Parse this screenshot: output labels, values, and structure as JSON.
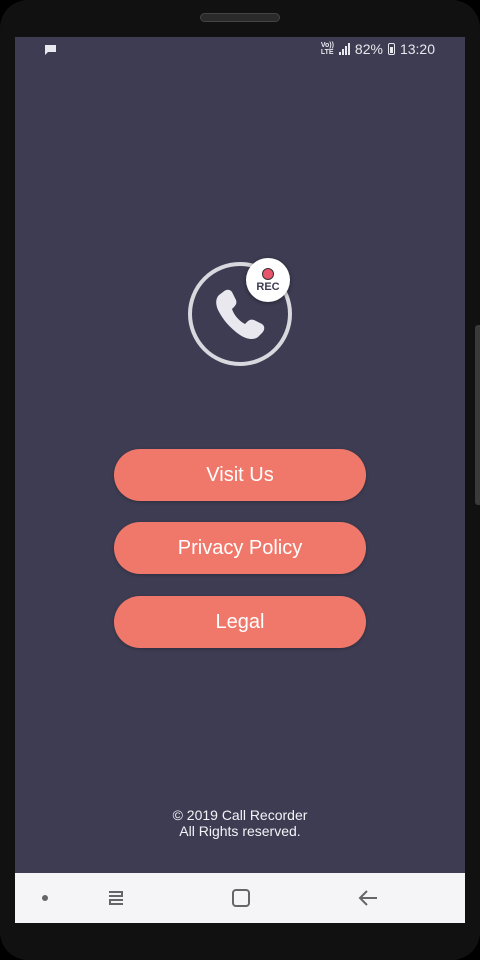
{
  "status_bar": {
    "battery": "82%",
    "time": "13:20",
    "network_top": "Vo))",
    "network_bottom": "LTE",
    "icons": [
      "chat-notification-icon",
      "signal-icon",
      "battery-icon"
    ]
  },
  "logo": {
    "badge_text": "REC",
    "icon": "phone-icon"
  },
  "buttons": {
    "visit": "Visit Us",
    "privacy": "Privacy Policy",
    "legal": "Legal"
  },
  "footer": {
    "copyright": "© 2019 Call Recorder",
    "rights": "All Rights reserved."
  },
  "colors": {
    "background": "#3d3c52",
    "button": "#f0786b",
    "rec_dot": "#e8556b",
    "nav_bar": "#f5f5f7"
  },
  "nav_bar": {
    "icons": [
      "dot-icon",
      "recent-apps-icon",
      "home-icon",
      "back-icon"
    ]
  }
}
